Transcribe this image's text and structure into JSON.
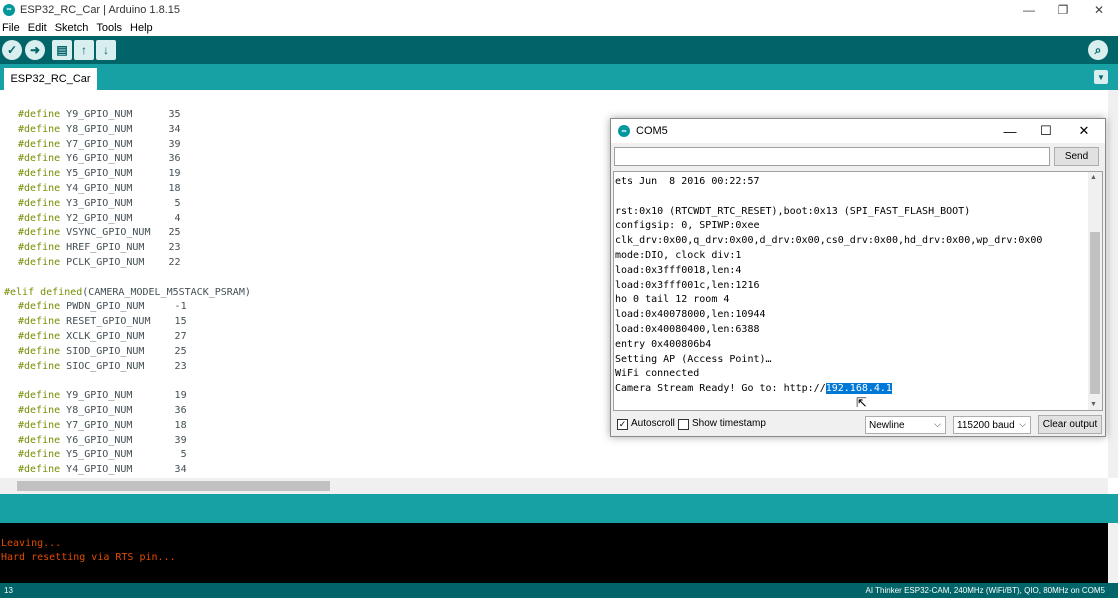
{
  "window": {
    "title": "ESP32_RC_Car | Arduino 1.8.15",
    "minimize": "—",
    "restore": "❐",
    "close": "✕"
  },
  "menu": [
    "File",
    "Edit",
    "Sketch",
    "Tools",
    "Help"
  ],
  "toolbar": {
    "verify": "✓",
    "upload": "➜",
    "new": "▤",
    "open": "↑",
    "save": "↓",
    "serial_monitor": "⌕"
  },
  "tabs": {
    "active": "ESP32_RC_Car",
    "menu_icon": "▼"
  },
  "code_lines": [
    {
      "kw": "#define",
      "rest": " Y9_GPIO_NUM      35"
    },
    {
      "kw": "#define",
      "rest": " Y8_GPIO_NUM      34"
    },
    {
      "kw": "#define",
      "rest": " Y7_GPIO_NUM      39"
    },
    {
      "kw": "#define",
      "rest": " Y6_GPIO_NUM      36"
    },
    {
      "kw": "#define",
      "rest": " Y5_GPIO_NUM      19"
    },
    {
      "kw": "#define",
      "rest": " Y4_GPIO_NUM      18"
    },
    {
      "kw": "#define",
      "rest": " Y3_GPIO_NUM       5"
    },
    {
      "kw": "#define",
      "rest": " Y2_GPIO_NUM       4"
    },
    {
      "kw": "#define",
      "rest": " VSYNC_GPIO_NUM   25"
    },
    {
      "kw": "#define",
      "rest": " HREF_GPIO_NUM    23"
    },
    {
      "kw": "#define",
      "rest": " PCLK_GPIO_NUM    22"
    },
    {
      "kw": "",
      "rest": ""
    },
    {
      "kw": "#elif defined",
      "rest": "(CAMERA_MODEL_M5STACK_PSRAM)"
    },
    {
      "kw": "#define",
      "rest": " PWDN_GPIO_NUM     -1"
    },
    {
      "kw": "#define",
      "rest": " RESET_GPIO_NUM    15"
    },
    {
      "kw": "#define",
      "rest": " XCLK_GPIO_NUM     27"
    },
    {
      "kw": "#define",
      "rest": " SIOD_GPIO_NUM     25"
    },
    {
      "kw": "#define",
      "rest": " SIOC_GPIO_NUM     23"
    },
    {
      "kw": "",
      "rest": ""
    },
    {
      "kw": "#define",
      "rest": " Y9_GPIO_NUM       19"
    },
    {
      "kw": "#define",
      "rest": " Y8_GPIO_NUM       36"
    },
    {
      "kw": "#define",
      "rest": " Y7_GPIO_NUM       18"
    },
    {
      "kw": "#define",
      "rest": " Y6_GPIO_NUM       39"
    },
    {
      "kw": "#define",
      "rest": " Y5_GPIO_NUM        5"
    },
    {
      "kw": "#define",
      "rest": " Y4_GPIO_NUM       34"
    }
  ],
  "console": {
    "lines": [
      "Leaving...",
      "Hard resetting via RTS pin..."
    ]
  },
  "statusbar": {
    "line": "13",
    "board": "AI Thinker ESP32-CAM, 240MHz (WiFi/BT), QIO, 80MHz on COM5"
  },
  "serial_monitor": {
    "title": "COM5",
    "input_value": "",
    "send_label": "Send",
    "output_lines": [
      "ets Jun  8 2016 00:22:57",
      "",
      "rst:0x10 (RTCWDT_RTC_RESET),boot:0x13 (SPI_FAST_FLASH_BOOT)",
      "configsip: 0, SPIWP:0xee",
      "clk_drv:0x00,q_drv:0x00,d_drv:0x00,cs0_drv:0x00,hd_drv:0x00,wp_drv:0x00",
      "mode:DIO, clock div:1",
      "load:0x3fff0018,len:4",
      "load:0x3fff001c,len:1216",
      "ho 0 tail 12 room 4",
      "load:0x40078000,len:10944",
      "load:0x40080400,len:6388",
      "entry 0x400806b4",
      "Setting AP (Access Point)…",
      "WiFi connected"
    ],
    "last_line_prefix": "Camera Stream Ready! Go to: http://",
    "selected_text": "192.168.4.1",
    "autoscroll_label": "Autoscroll",
    "autoscroll_checked": "✓",
    "timestamp_label": "Show timestamp",
    "line_ending": "Newline",
    "baud": "115200 baud",
    "clear_label": "Clear output"
  }
}
